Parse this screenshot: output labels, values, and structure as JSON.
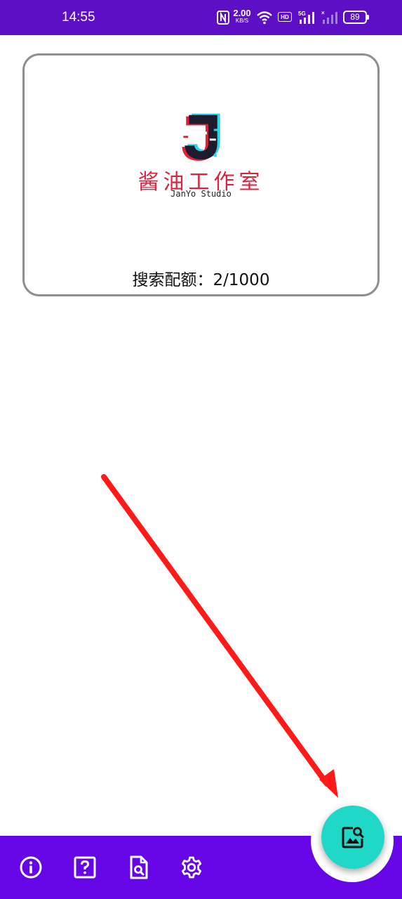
{
  "status_bar": {
    "time": "14:55",
    "net_speed_value": "2.00",
    "net_speed_unit": "KB/S",
    "hd_label": "HD",
    "network_type": "5G",
    "battery_level": "89"
  },
  "card": {
    "logo_text": "酱油工作室",
    "logo_subtext": "JanYo Studio",
    "quota_text": "搜索配额：2/1000"
  },
  "bottom_nav": {
    "items": [
      {
        "icon": "info-icon"
      },
      {
        "icon": "help-icon"
      },
      {
        "icon": "document-search-icon"
      },
      {
        "icon": "settings-icon"
      }
    ],
    "fab_icon": "image-search-icon"
  },
  "colors": {
    "status_bar": "#5c0fc4",
    "bottom_bar": "#6606e6",
    "fab": "#1fd8c7",
    "arrow": "#ff1a1a",
    "logo_red": "#d7263d",
    "logo_cyan": "#2ed3e6"
  }
}
